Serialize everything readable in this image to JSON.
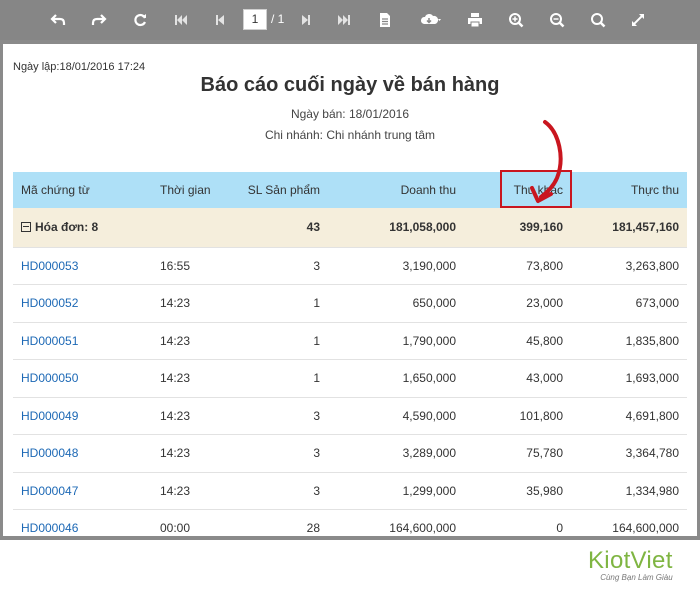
{
  "toolbar": {
    "buttons": [
      {
        "name": "undo-icon"
      },
      {
        "name": "redo-icon"
      },
      {
        "name": "refresh-icon"
      },
      {
        "name": "first-page-icon"
      },
      {
        "name": "prev-page-icon"
      },
      {
        "name": "next-page-icon"
      },
      {
        "name": "last-page-icon"
      },
      {
        "name": "document-icon"
      },
      {
        "name": "cloud-download-icon"
      },
      {
        "name": "print-icon"
      },
      {
        "name": "zoom-in-icon"
      },
      {
        "name": "zoom-out-icon"
      },
      {
        "name": "search-icon"
      },
      {
        "name": "fullscreen-icon"
      }
    ],
    "page_current": "1",
    "page_total": "/ 1"
  },
  "report": {
    "created": "Ngày lập:18/01/2016 17:24",
    "title": "Báo cáo cuối ngày về bán hàng",
    "sale_date": "Ngày bán: 18/01/2016",
    "branch": "Chi nhánh: Chi nhánh trung tâm"
  },
  "table": {
    "headers": [
      "Mã chứng từ",
      "Thời gian",
      "SL Sản phẩm",
      "Doanh thu",
      "Thu khác",
      "Thực thu"
    ],
    "group": {
      "label": "Hóa đơn: 8",
      "qty": "43",
      "revenue": "181,058,000",
      "other": "399,160",
      "actual": "181,457,160"
    },
    "rows": [
      [
        "HD000053",
        "16:55",
        "3",
        "3,190,000",
        "73,800",
        "3,263,800"
      ],
      [
        "HD000052",
        "14:23",
        "1",
        "650,000",
        "23,000",
        "673,000"
      ],
      [
        "HD000051",
        "14:23",
        "1",
        "1,790,000",
        "45,800",
        "1,835,800"
      ],
      [
        "HD000050",
        "14:23",
        "1",
        "1,650,000",
        "43,000",
        "1,693,000"
      ],
      [
        "HD000049",
        "14:23",
        "3",
        "4,590,000",
        "101,800",
        "4,691,800"
      ],
      [
        "HD000048",
        "14:23",
        "3",
        "3,289,000",
        "75,780",
        "3,364,780"
      ],
      [
        "HD000047",
        "14:23",
        "3",
        "1,299,000",
        "35,980",
        "1,334,980"
      ],
      [
        "HD000046",
        "00:00",
        "28",
        "164,600,000",
        "0",
        "164,600,000"
      ]
    ]
  },
  "brand": {
    "name": "KiotViet",
    "slogan": "Cùng Bạn Làm Giàu"
  },
  "colors": {
    "toolbar": "#868686",
    "header": "#aee0f7",
    "group": "#f5eedc",
    "link": "#1c68b5",
    "highlight": "#c9161f",
    "brand": "#7fb542"
  }
}
